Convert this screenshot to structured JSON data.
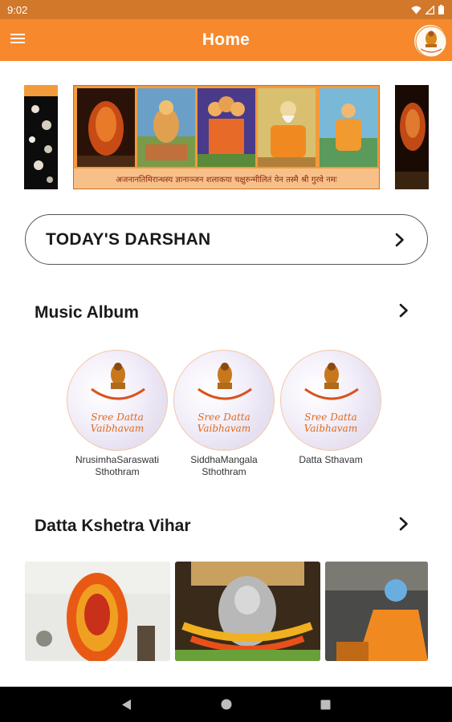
{
  "status_bar": {
    "time": "9:02",
    "icons": [
      "wifi-icon",
      "signal-icon",
      "battery-icon"
    ]
  },
  "app_bar": {
    "title": "Home",
    "menu_icon": "menu-icon",
    "logo": "app-logo"
  },
  "banner": {
    "caption": "अजनानतिमिरान्धस्य ज्ञानाञ्जन शलाकया चक्षुरुन्मीलितं येन तस्मै श्री गुरवे नमः"
  },
  "darshan": {
    "label": "TODAY'S DARSHAN"
  },
  "music_album": {
    "title": "Music Album",
    "items": [
      {
        "title": "NrusimhaSaraswati Sthothram",
        "cover_text": "Sree Datta Vaibhavam"
      },
      {
        "title": "SiddhaMangala Sthothram",
        "cover_text": "Sree Datta Vaibhavam"
      },
      {
        "title": "Datta Sthavam",
        "cover_text": "Sree Datta Vaibhavam"
      }
    ]
  },
  "kshetra": {
    "title": "Datta Kshetra Vihar"
  },
  "colors": {
    "accent": "#f7892c",
    "status_bar": "#d2782a",
    "nav_bar": "#000000"
  }
}
